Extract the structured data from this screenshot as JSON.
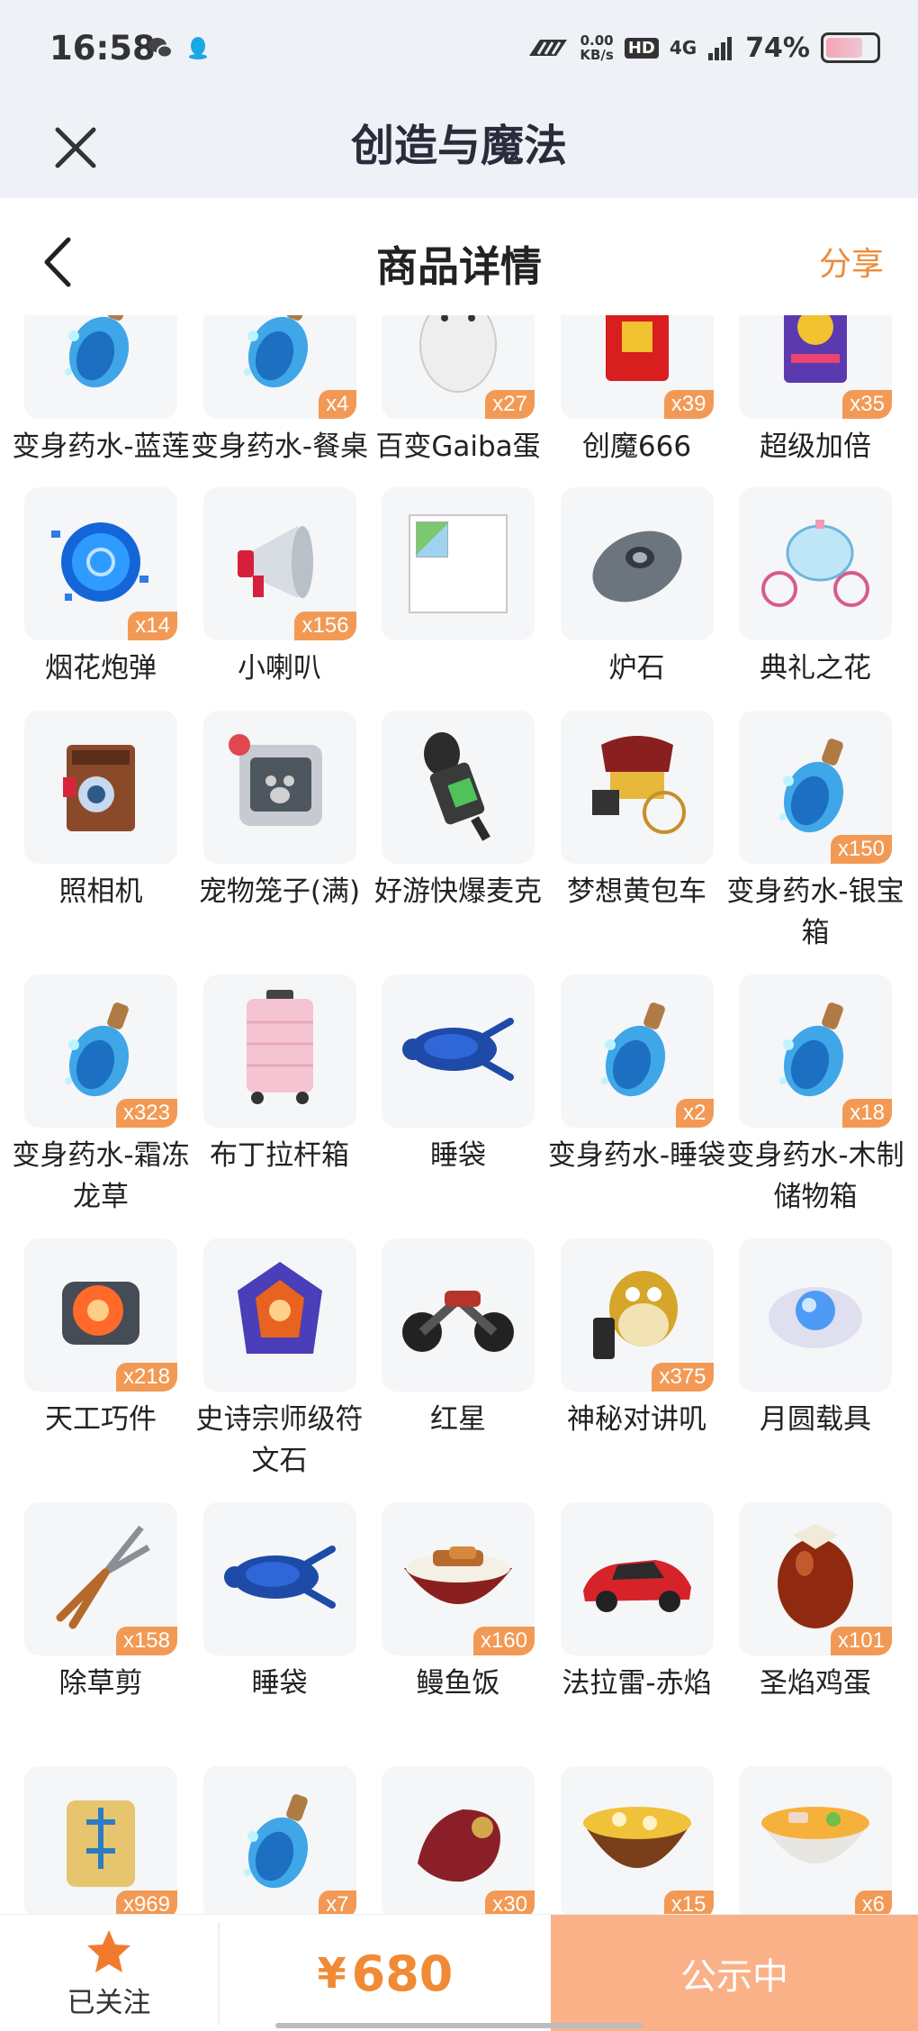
{
  "status_bar": {
    "time": "16:58",
    "speed_value": "0.00",
    "speed_unit": "KB/s",
    "hd": "HD",
    "network": "4G",
    "battery": "74%",
    "battery_level": 0.74,
    "icons": [
      "wechat-icon",
      "qq-icon",
      "carrier-logo-icon",
      "signal-icon",
      "battery-icon"
    ]
  },
  "titlebar": {
    "title": "创造与魔法"
  },
  "page_header": {
    "title": "商品详情",
    "share_label": "分享"
  },
  "items": [
    {
      "name": "变身药水-蓝莲",
      "qty": "",
      "icon": "potion-icon"
    },
    {
      "name": "变身药水-餐桌",
      "qty": "x4",
      "icon": "potion-icon"
    },
    {
      "name": "百变Gaiba蛋",
      "qty": "x27",
      "icon": "egg-icon"
    },
    {
      "name": "创魔666",
      "qty": "x39",
      "icon": "red-envelope-icon"
    },
    {
      "name": "超级加倍",
      "qty": "x35",
      "icon": "card-icon"
    },
    {
      "name": "烟花炮弹",
      "qty": "x14",
      "icon": "firework-shell-icon"
    },
    {
      "name": "小喇叭",
      "qty": "x156",
      "icon": "megaphone-icon"
    },
    {
      "name": "",
      "qty": "",
      "icon": "broken-image-icon"
    },
    {
      "name": "炉石",
      "qty": "",
      "icon": "hearthstone-icon"
    },
    {
      "name": "典礼之花",
      "qty": "",
      "icon": "carriage-icon"
    },
    {
      "name": "照相机",
      "qty": "",
      "icon": "camera-icon"
    },
    {
      "name": "宠物笼子(满)",
      "qty": "",
      "icon": "pet-cage-icon"
    },
    {
      "name": "好游快爆麦克",
      "qty": "",
      "icon": "microphone-icon"
    },
    {
      "name": "梦想黄包车",
      "qty": "",
      "icon": "rickshaw-icon"
    },
    {
      "name": "变身药水-银宝箱",
      "qty": "x150",
      "icon": "potion-icon"
    },
    {
      "name": "变身药水-霜冻龙草",
      "qty": "x323",
      "icon": "potion-icon"
    },
    {
      "name": "布丁拉杆箱",
      "qty": "",
      "icon": "suitcase-icon"
    },
    {
      "name": "睡袋",
      "qty": "",
      "icon": "sleeping-bag-icon"
    },
    {
      "name": "变身药水-睡袋",
      "qty": "x2",
      "icon": "potion-icon"
    },
    {
      "name": "变身药水-木制储物箱",
      "qty": "x18",
      "icon": "potion-icon"
    },
    {
      "name": "天工巧件",
      "qty": "x218",
      "icon": "gear-part-icon"
    },
    {
      "name": "史诗宗师级符文石",
      "qty": "",
      "icon": "rune-stone-icon"
    },
    {
      "name": "红星",
      "qty": "",
      "icon": "motorcycle-icon"
    },
    {
      "name": "神秘对讲叽",
      "qty": "x375",
      "icon": "walkie-talkie-bird-icon"
    },
    {
      "name": "月圆载具",
      "qty": "",
      "icon": "moon-vehicle-icon"
    },
    {
      "name": "除草剪",
      "qty": "x158",
      "icon": "shears-icon"
    },
    {
      "name": "睡袋",
      "qty": "",
      "icon": "sleeping-bag-icon"
    },
    {
      "name": "鳗鱼饭",
      "qty": "x160",
      "icon": "eel-rice-icon"
    },
    {
      "name": "法拉雷-赤焰",
      "qty": "",
      "icon": "sports-car-icon"
    },
    {
      "name": "圣焰鸡蛋",
      "qty": "x101",
      "icon": "roast-egg-icon"
    },
    {
      "name": "",
      "qty": "x969",
      "icon": "scroll-icon"
    },
    {
      "name": "",
      "qty": "x7",
      "icon": "potion-icon"
    },
    {
      "name": "",
      "qty": "x30",
      "icon": "saddle-icon"
    },
    {
      "name": "",
      "qty": "x15",
      "icon": "soup-icon"
    },
    {
      "name": "",
      "qty": "x6",
      "icon": "noodle-bowl-icon"
    }
  ],
  "bottom_bar": {
    "follow_label": "已关注",
    "currency": "¥",
    "price": "680",
    "status_label": "公示中"
  },
  "colors": {
    "accent": "#f08a34",
    "badge": "#f29a55",
    "status_button": "#fbb188",
    "header_bg": "#eef1f6"
  }
}
